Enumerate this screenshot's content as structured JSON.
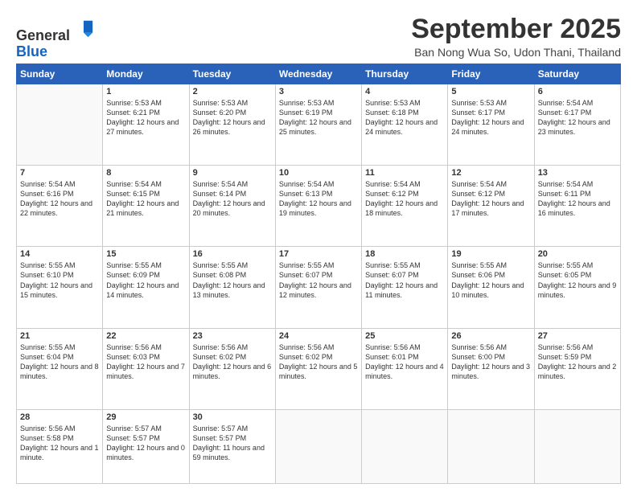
{
  "logo": {
    "general": "General",
    "blue": "Blue"
  },
  "header": {
    "month": "September 2025",
    "location": "Ban Nong Wua So, Udon Thani, Thailand"
  },
  "days_of_week": [
    "Sunday",
    "Monday",
    "Tuesday",
    "Wednesday",
    "Thursday",
    "Friday",
    "Saturday"
  ],
  "weeks": [
    [
      {
        "day": "",
        "info": ""
      },
      {
        "day": "1",
        "info": "Sunrise: 5:53 AM\nSunset: 6:21 PM\nDaylight: 12 hours\nand 27 minutes."
      },
      {
        "day": "2",
        "info": "Sunrise: 5:53 AM\nSunset: 6:20 PM\nDaylight: 12 hours\nand 26 minutes."
      },
      {
        "day": "3",
        "info": "Sunrise: 5:53 AM\nSunset: 6:19 PM\nDaylight: 12 hours\nand 25 minutes."
      },
      {
        "day": "4",
        "info": "Sunrise: 5:53 AM\nSunset: 6:18 PM\nDaylight: 12 hours\nand 24 minutes."
      },
      {
        "day": "5",
        "info": "Sunrise: 5:53 AM\nSunset: 6:17 PM\nDaylight: 12 hours\nand 24 minutes."
      },
      {
        "day": "6",
        "info": "Sunrise: 5:54 AM\nSunset: 6:17 PM\nDaylight: 12 hours\nand 23 minutes."
      }
    ],
    [
      {
        "day": "7",
        "info": "Sunrise: 5:54 AM\nSunset: 6:16 PM\nDaylight: 12 hours\nand 22 minutes."
      },
      {
        "day": "8",
        "info": "Sunrise: 5:54 AM\nSunset: 6:15 PM\nDaylight: 12 hours\nand 21 minutes."
      },
      {
        "day": "9",
        "info": "Sunrise: 5:54 AM\nSunset: 6:14 PM\nDaylight: 12 hours\nand 20 minutes."
      },
      {
        "day": "10",
        "info": "Sunrise: 5:54 AM\nSunset: 6:13 PM\nDaylight: 12 hours\nand 19 minutes."
      },
      {
        "day": "11",
        "info": "Sunrise: 5:54 AM\nSunset: 6:12 PM\nDaylight: 12 hours\nand 18 minutes."
      },
      {
        "day": "12",
        "info": "Sunrise: 5:54 AM\nSunset: 6:12 PM\nDaylight: 12 hours\nand 17 minutes."
      },
      {
        "day": "13",
        "info": "Sunrise: 5:54 AM\nSunset: 6:11 PM\nDaylight: 12 hours\nand 16 minutes."
      }
    ],
    [
      {
        "day": "14",
        "info": "Sunrise: 5:55 AM\nSunset: 6:10 PM\nDaylight: 12 hours\nand 15 minutes."
      },
      {
        "day": "15",
        "info": "Sunrise: 5:55 AM\nSunset: 6:09 PM\nDaylight: 12 hours\nand 14 minutes."
      },
      {
        "day": "16",
        "info": "Sunrise: 5:55 AM\nSunset: 6:08 PM\nDaylight: 12 hours\nand 13 minutes."
      },
      {
        "day": "17",
        "info": "Sunrise: 5:55 AM\nSunset: 6:07 PM\nDaylight: 12 hours\nand 12 minutes."
      },
      {
        "day": "18",
        "info": "Sunrise: 5:55 AM\nSunset: 6:07 PM\nDaylight: 12 hours\nand 11 minutes."
      },
      {
        "day": "19",
        "info": "Sunrise: 5:55 AM\nSunset: 6:06 PM\nDaylight: 12 hours\nand 10 minutes."
      },
      {
        "day": "20",
        "info": "Sunrise: 5:55 AM\nSunset: 6:05 PM\nDaylight: 12 hours\nand 9 minutes."
      }
    ],
    [
      {
        "day": "21",
        "info": "Sunrise: 5:55 AM\nSunset: 6:04 PM\nDaylight: 12 hours\nand 8 minutes."
      },
      {
        "day": "22",
        "info": "Sunrise: 5:56 AM\nSunset: 6:03 PM\nDaylight: 12 hours\nand 7 minutes."
      },
      {
        "day": "23",
        "info": "Sunrise: 5:56 AM\nSunset: 6:02 PM\nDaylight: 12 hours\nand 6 minutes."
      },
      {
        "day": "24",
        "info": "Sunrise: 5:56 AM\nSunset: 6:02 PM\nDaylight: 12 hours\nand 5 minutes."
      },
      {
        "day": "25",
        "info": "Sunrise: 5:56 AM\nSunset: 6:01 PM\nDaylight: 12 hours\nand 4 minutes."
      },
      {
        "day": "26",
        "info": "Sunrise: 5:56 AM\nSunset: 6:00 PM\nDaylight: 12 hours\nand 3 minutes."
      },
      {
        "day": "27",
        "info": "Sunrise: 5:56 AM\nSunset: 5:59 PM\nDaylight: 12 hours\nand 2 minutes."
      }
    ],
    [
      {
        "day": "28",
        "info": "Sunrise: 5:56 AM\nSunset: 5:58 PM\nDaylight: 12 hours\nand 1 minute."
      },
      {
        "day": "29",
        "info": "Sunrise: 5:57 AM\nSunset: 5:57 PM\nDaylight: 12 hours\nand 0 minutes."
      },
      {
        "day": "30",
        "info": "Sunrise: 5:57 AM\nSunset: 5:57 PM\nDaylight: 11 hours\nand 59 minutes."
      },
      {
        "day": "",
        "info": ""
      },
      {
        "day": "",
        "info": ""
      },
      {
        "day": "",
        "info": ""
      },
      {
        "day": "",
        "info": ""
      }
    ]
  ]
}
